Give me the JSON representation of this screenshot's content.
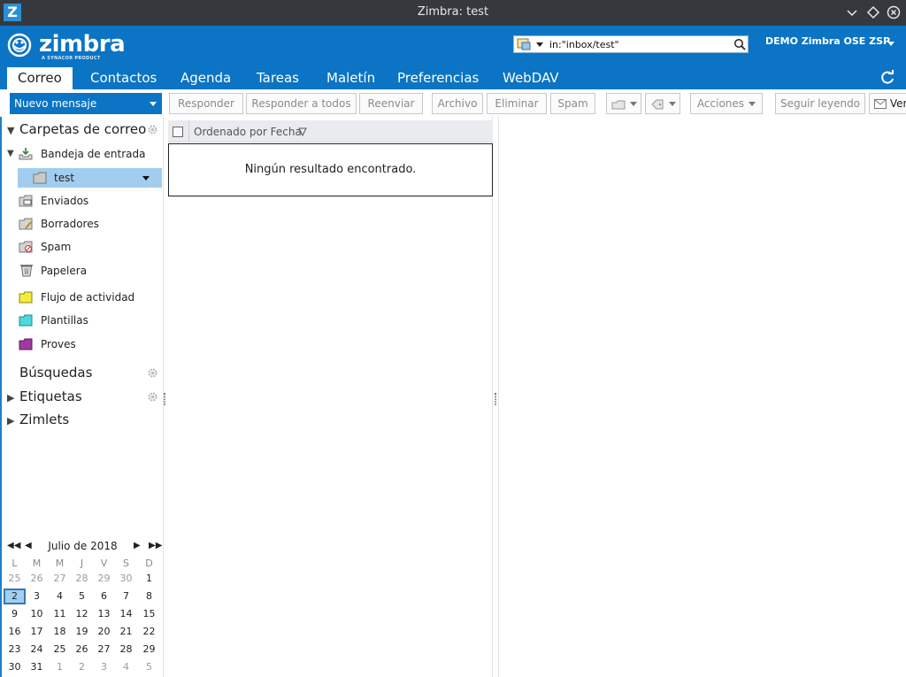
{
  "window": {
    "title": "Zimbra: test",
    "app_icon_letter": "Z"
  },
  "brand": {
    "name": "zimbra",
    "tagline": "A SYNACOR PRODUCT"
  },
  "search": {
    "value": "in:\"inbox/test\"",
    "placeholder": ""
  },
  "user": {
    "name": "DEMO Zimbra OSE ZSP"
  },
  "app_tabs": [
    "Correo",
    "Contactos",
    "Agenda",
    "Tareas",
    "Maletín",
    "Preferencias",
    "WebDAV"
  ],
  "toolbar": {
    "new_message": "Nuevo mensaje",
    "reply": "Responder",
    "reply_all": "Responder a todos",
    "forward": "Reenviar",
    "archive": "Archivo",
    "delete": "Eliminar",
    "spam": "Spam",
    "actions": "Acciones",
    "keep_reading": "Seguir leyendo",
    "view": "Ver"
  },
  "folders": {
    "header": "Carpetas de correo",
    "inbox": "Bandeja de entrada",
    "test": "test",
    "sent": "Enviados",
    "drafts": "Borradores",
    "spam": "Spam",
    "trash": "Papelera",
    "activity": "Flujo de actividad",
    "templates": "Plantillas",
    "proves": "Proves"
  },
  "sections": {
    "searches": "Búsquedas",
    "tags": "Etiquetas",
    "zimlets": "Zimlets"
  },
  "list": {
    "sort_label": "Ordenado por Fecha",
    "empty_message": "Ningún resultado encontrado."
  },
  "calendar": {
    "month_label": "Julio de 2018",
    "weekdays": [
      "L",
      "M",
      "M",
      "J",
      "V",
      "S",
      "D"
    ],
    "weeks": [
      [
        "25",
        "26",
        "27",
        "28",
        "29",
        "30",
        "1"
      ],
      [
        "2",
        "3",
        "4",
        "5",
        "6",
        "7",
        "8"
      ],
      [
        "9",
        "10",
        "11",
        "12",
        "13",
        "14",
        "15"
      ],
      [
        "16",
        "17",
        "18",
        "19",
        "20",
        "21",
        "22"
      ],
      [
        "23",
        "24",
        "25",
        "26",
        "27",
        "28",
        "29"
      ],
      [
        "30",
        "31",
        "1",
        "2",
        "3",
        "4",
        "5"
      ]
    ],
    "today": "2"
  },
  "colors": {
    "brand_blue": "#0b74c4",
    "selected_row": "#a2cdee",
    "titlebar": "#35393d"
  }
}
